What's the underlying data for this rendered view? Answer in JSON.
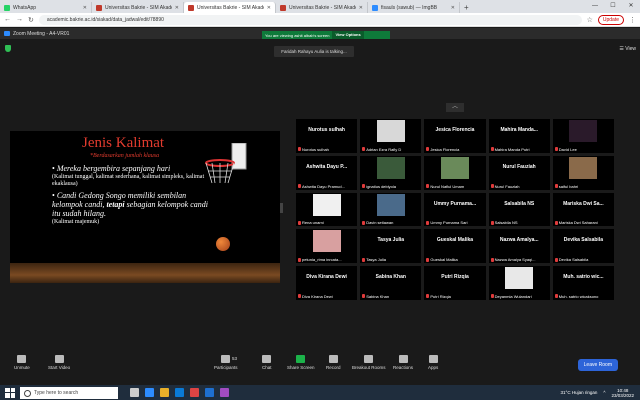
{
  "browser": {
    "tabs": [
      {
        "label": "WhatsApp",
        "color": "#25d366",
        "active": false
      },
      {
        "label": "Universitas Bakrie - SIM Akadem",
        "color": "#c0392b",
        "active": false
      },
      {
        "label": "Universitas Bakrie - SIM Akadem",
        "color": "#c0392b",
        "active": true
      },
      {
        "label": "Universitas Bakrie - SIM Akadem",
        "color": "#c0392b",
        "active": false
      },
      {
        "label": "fisauls (sawub) — ImgBB",
        "color": "#2d8cff",
        "active": false
      }
    ],
    "url": "academic.bakrie.ac.id/siakad/data_jadwal/edit/78890",
    "update_label": "Update"
  },
  "zoom": {
    "window_title": "Zoom Meeting - A4-VR01",
    "banner_text": "You are viewing ashit albab's screen",
    "view_options": "View Options",
    "view_label": "View",
    "talking": "Faridah Rahayu Aulia is talking..."
  },
  "slide": {
    "title": "Jenis Kalimat",
    "subtitle": "*Berdasarkan jumlah klausa",
    "bullet1": "Mereka bergembira sepanjang hari",
    "note1": "(Kalimat tunggal, kalimat sederhana, kalimat simpleks, kalimat ekaklausa)",
    "bullet2_a": "Candi Gedong Songo memiliki sembilan kelompok candi, ",
    "bullet2_b": "tetapi",
    "bullet2_c": " sebagian kelompok candi itu sudah hilang.",
    "note2": "(Kalimat majemuk)"
  },
  "participants": [
    {
      "name": "Nurotus sulhah",
      "label": "Nurotus sulhah",
      "photo": false
    },
    {
      "name": "",
      "label": "Adrian Ezra Rafly D",
      "photo": true,
      "photo_color": "#d8d8d8"
    },
    {
      "name": "Jesica Florencia",
      "label": "Jesica Florencia",
      "photo": false
    },
    {
      "name": "Mahira Manda...",
      "label": "Mahira Manda Putri",
      "photo": false
    },
    {
      "name": "",
      "label": "David Lee",
      "photo": true,
      "photo_color": "#2a1a2a"
    },
    {
      "name": "Ashwita Dayu P...",
      "label": "Ashwita Dayu Pramud...",
      "photo": false
    },
    {
      "name": "",
      "label": "ignatius deblyola",
      "photo": true,
      "photo_color": "#3a5a3a"
    },
    {
      "name": "",
      "label": "Nurul Naflul Umam",
      "photo": true,
      "photo_color": "#6a8a5a"
    },
    {
      "name": "Nurul Fauziah",
      "label": "Nurul Fauziah",
      "photo": false
    },
    {
      "name": "",
      "label": "saiful bahri",
      "photo": true,
      "photo_color": "#8a6a4a"
    },
    {
      "name": "",
      "label": "Rena unarni",
      "photo": true,
      "photo_color": "#f0f0f0"
    },
    {
      "name": "",
      "label": "Davin setiawan",
      "photo": true,
      "photo_color": "#4a6a8a"
    },
    {
      "name": "Ummy Purnama...",
      "label": "Ummy Purnama Sari",
      "photo": false
    },
    {
      "name": "Salsabila NS",
      "label": "Salsabila NS",
      "photo": false
    },
    {
      "name": "Mariska Dwi Sa...",
      "label": "Mariska Dwi Saharani",
      "photo": false
    },
    {
      "name": "",
      "label": "petunia_rima inrcata...",
      "photo": true,
      "photo_color": "#d8a0a0"
    },
    {
      "name": "Tasya Julia",
      "label": "Tasya Julia",
      "photo": false
    },
    {
      "name": "Gueskal Malika",
      "label": "Gueskal Malika",
      "photo": false
    },
    {
      "name": "Nazwa Amalya...",
      "label": "Nazwa Amalya Syaqi...",
      "photo": false
    },
    {
      "name": "Devika Salsabila",
      "label": "Devika Salsabila",
      "photo": false
    },
    {
      "name": "Diva Kirana Dewi",
      "label": "Diva Kirana Dewi",
      "photo": false
    },
    {
      "name": "Sabina Khan",
      "label": "Sabina Khan",
      "photo": false
    },
    {
      "name": "Putri Rizqia",
      "label": "Putri Rizqia",
      "photo": false
    },
    {
      "name": "",
      "label": "Deyanmia Wulandari",
      "photo": true,
      "photo_color": "#e8e8e8"
    },
    {
      "name": "Muh. satrio wic...",
      "label": "Muh. satrio wicaksono",
      "photo": false
    }
  ],
  "toolbar": {
    "unmute": "Unmute",
    "start_video": "Start Video",
    "participants": "Participants",
    "participants_count": "53",
    "chat": "Chat",
    "share_screen": "Share Screen",
    "record": "Record",
    "breakout": "Breakout Rooms",
    "reactions": "Reactions",
    "apps": "Apps",
    "leave": "Leave Room"
  },
  "taskbar": {
    "search_placeholder": "Type here to search",
    "weather": "31°C  Hujan ringan",
    "time": "10:48",
    "date": "23/03/2022"
  }
}
